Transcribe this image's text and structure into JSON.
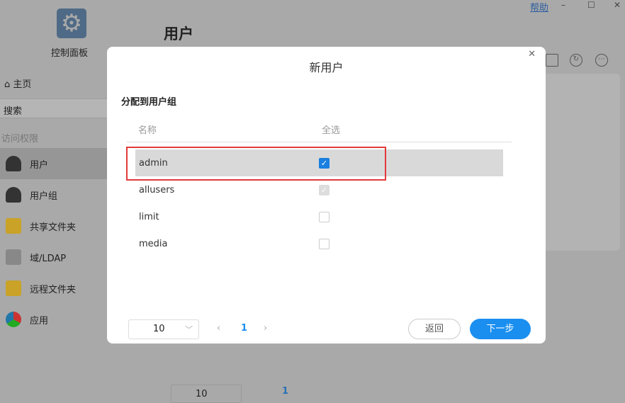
{
  "app": {
    "title": "控制面板",
    "help": "帮助",
    "page_title": "用户"
  },
  "sidebar": {
    "home": "主页",
    "search": "搜索",
    "section": "访问权限",
    "items": [
      {
        "label": "用户"
      },
      {
        "label": "用户组"
      },
      {
        "label": "共享文件夹"
      },
      {
        "label": "域/LDAP"
      },
      {
        "label": "远程文件夹"
      },
      {
        "label": "应用"
      }
    ]
  },
  "dialog": {
    "title": "新用户",
    "group_label": "分配到用户组",
    "col_name": "名称",
    "col_select": "全选",
    "rows": [
      {
        "name": "admin",
        "checked": true
      },
      {
        "name": "allusers",
        "checked": true,
        "disabled": true
      },
      {
        "name": "limit",
        "checked": false
      },
      {
        "name": "media",
        "checked": false
      }
    ],
    "page_size": "10",
    "page": "1",
    "back": "返回",
    "next": "下一步"
  },
  "background_pager": {
    "page_size": "10",
    "page": "1"
  },
  "colors": {
    "accent": "#1a8ff0",
    "highlight": "#e23a3a"
  }
}
